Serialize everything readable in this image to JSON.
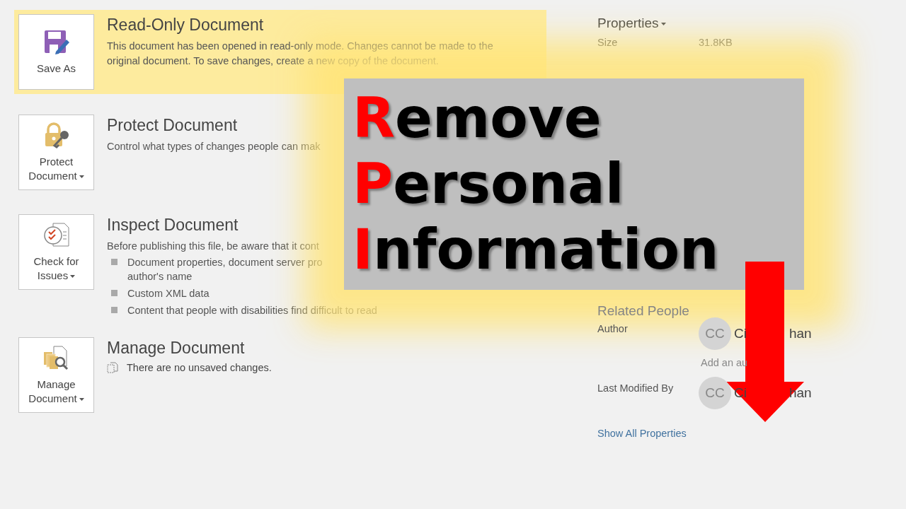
{
  "sections": [
    {
      "kind": "readonly",
      "highlighted": true,
      "button": {
        "label_lines": [
          "Save As"
        ],
        "dropdown": false
      },
      "title": "Read-Only Document",
      "description": "This document has been opened in read-only mode. Changes cannot be made to the original document. To save changes, create a new copy of the document."
    },
    {
      "kind": "protect",
      "highlighted": false,
      "button": {
        "label_lines": [
          "Protect",
          "Document"
        ],
        "dropdown": true
      },
      "title": "Protect Document",
      "description": "Control what types of changes people can mak"
    },
    {
      "kind": "inspect",
      "highlighted": false,
      "button": {
        "label_lines": [
          "Check for",
          "Issues"
        ],
        "dropdown": true
      },
      "title": "Inspect Document",
      "description": "Before publishing this file, be aware that it cont",
      "bullets": [
        "Document properties, document server pro\nauthor's name",
        "Custom XML data",
        "Content that people with disabilities find difficult to read"
      ]
    },
    {
      "kind": "manage",
      "highlighted": false,
      "button": {
        "label_lines": [
          "Manage",
          "Document"
        ],
        "dropdown": true
      },
      "title": "Manage Document",
      "status": "There are no unsaved changes."
    }
  ],
  "properties": {
    "title": "Properties",
    "rows": [
      {
        "label": "Size",
        "value": "31.8KB"
      }
    ]
  },
  "related_people": {
    "title": "Related People",
    "people": [
      {
        "label": "Author",
        "initials": "CC",
        "name_start": "Ci",
        "name_end": "han",
        "add_link": "Add an au"
      },
      {
        "label": "Last Modified By",
        "initials": "CC",
        "name_start": "Ci",
        "name_end": "han"
      }
    ],
    "show_all": "Show All Properties"
  },
  "overlay": {
    "lines": [
      {
        "initial": "R",
        "rest": "emove"
      },
      {
        "initial": "P",
        "rest": "ersonal"
      },
      {
        "initial": "I",
        "rest": "nformation"
      }
    ]
  }
}
